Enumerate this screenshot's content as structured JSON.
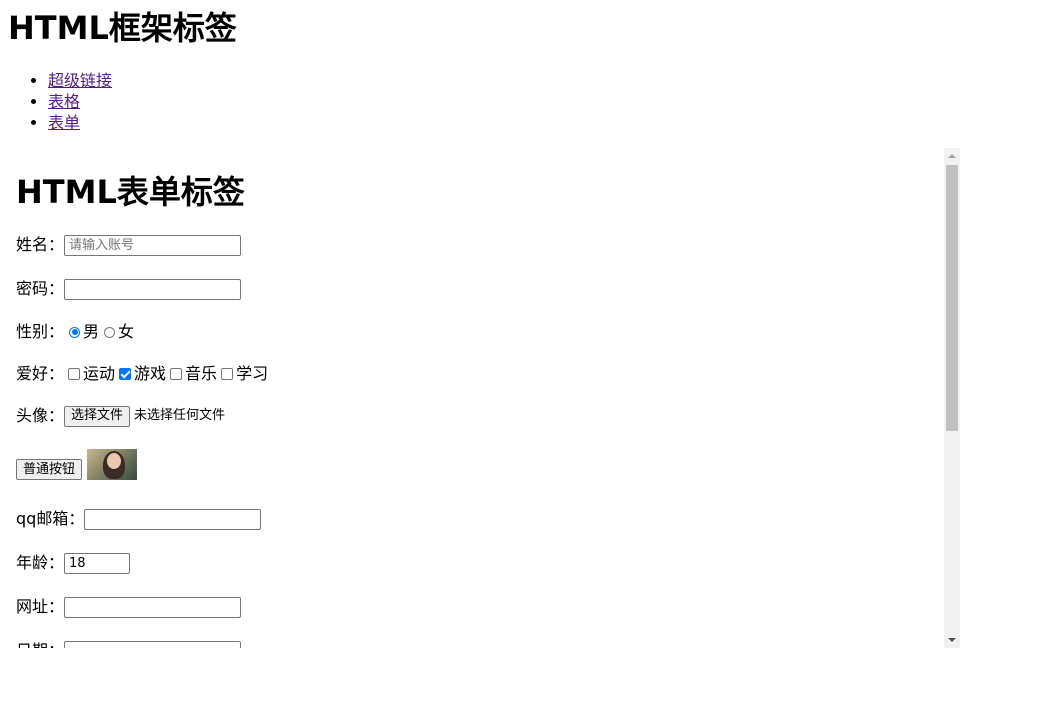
{
  "page": {
    "title": "HTML框架标签",
    "nav_links": [
      "超级链接",
      "表格",
      "表单"
    ]
  },
  "iframe": {
    "title": "HTML表单标签",
    "name_label": "姓名：",
    "name_placeholder": "请输入账号",
    "password_label": "密码：",
    "gender_label": "性别：",
    "gender_options": [
      {
        "label": "男",
        "checked": true
      },
      {
        "label": "女",
        "checked": false
      }
    ],
    "hobby_label": "爱好：",
    "hobby_options": [
      {
        "label": "运动",
        "checked": false
      },
      {
        "label": "游戏",
        "checked": true
      },
      {
        "label": "音乐",
        "checked": false
      },
      {
        "label": "学习",
        "checked": false
      }
    ],
    "avatar_label": "头像：",
    "file_button": "选择文件",
    "file_status": "未选择任何文件",
    "normal_button": "普通按钮",
    "email_label": "qq邮箱：",
    "age_label": "年龄：",
    "age_value": "18",
    "url_label": "网址：",
    "date_label": "日期："
  },
  "colors": {
    "link_visited": "#551a8b",
    "accent": "#0075ff",
    "scroll_thumb": "#c1c1c1"
  }
}
